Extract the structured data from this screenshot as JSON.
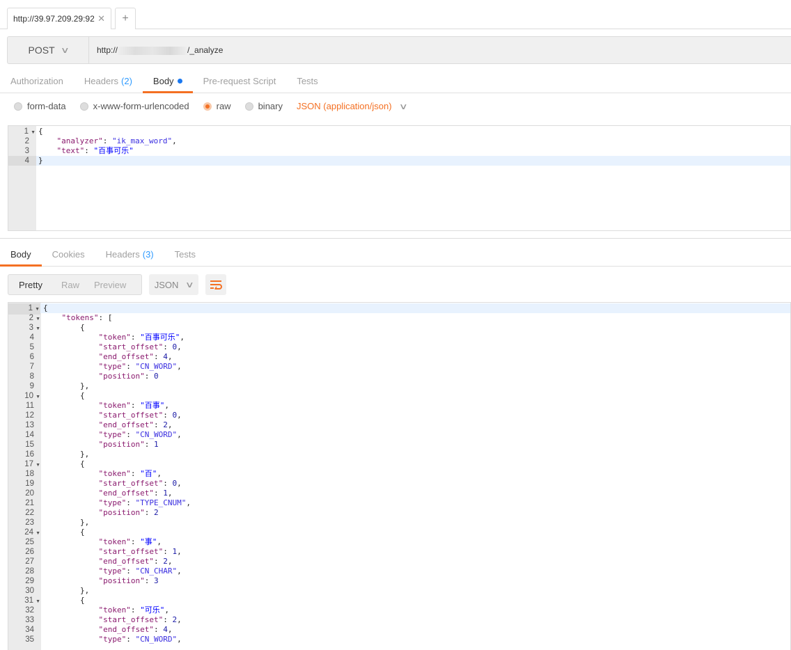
{
  "tabs": [
    {
      "label": "http://39.97.209.29:92"
    }
  ],
  "tab_close": "✕",
  "tab_add": "+",
  "request": {
    "method": "POST",
    "url_prefix": "http://",
    "url_suffix": "/_analyze"
  },
  "request_tabs": [
    {
      "label": "Authorization"
    },
    {
      "label": "Headers",
      "count": "(2)"
    },
    {
      "label": "Body",
      "active": true
    },
    {
      "label": "Pre-request Script"
    },
    {
      "label": "Tests"
    }
  ],
  "body_modes": [
    {
      "label": "form-data"
    },
    {
      "label": "x-www-form-urlencoded"
    },
    {
      "label": "raw",
      "selected": true
    },
    {
      "label": "binary"
    }
  ],
  "content_type": "JSON (application/json)",
  "request_body": [
    "{",
    "    \"analyzer\": \"ik_max_word\",",
    "    \"text\": \"百事可乐\"",
    "}"
  ],
  "response_tabs": [
    {
      "label": "Body",
      "active": true
    },
    {
      "label": "Cookies"
    },
    {
      "label": "Headers",
      "count": "(3)"
    },
    {
      "label": "Tests"
    }
  ],
  "view_modes": [
    "Pretty",
    "Raw",
    "Preview"
  ],
  "response_format": "JSON",
  "colors": {
    "accent": "#f47023",
    "key": "#8a1a6e",
    "string": "#3a2ee0",
    "number": "#1a1aa6"
  },
  "response_body": [
    "{",
    "    \"tokens\": [",
    "        {",
    "            \"token\": \"百事可乐\",",
    "            \"start_offset\": 0,",
    "            \"end_offset\": 4,",
    "            \"type\": \"CN_WORD\",",
    "            \"position\": 0",
    "        },",
    "        {",
    "            \"token\": \"百事\",",
    "            \"start_offset\": 0,",
    "            \"end_offset\": 2,",
    "            \"type\": \"CN_WORD\",",
    "            \"position\": 1",
    "        },",
    "        {",
    "            \"token\": \"百\",",
    "            \"start_offset\": 0,",
    "            \"end_offset\": 1,",
    "            \"type\": \"TYPE_CNUM\",",
    "            \"position\": 2",
    "        },",
    "        {",
    "            \"token\": \"事\",",
    "            \"start_offset\": 1,",
    "            \"end_offset\": 2,",
    "            \"type\": \"CN_CHAR\",",
    "            \"position\": 3",
    "        },",
    "        {",
    "            \"token\": \"可乐\",",
    "            \"start_offset\": 2,",
    "            \"end_offset\": 4,",
    "            \"type\": \"CN_WORD\","
  ],
  "response_fold_lines": [
    1,
    2,
    3,
    10,
    17,
    24,
    31
  ]
}
